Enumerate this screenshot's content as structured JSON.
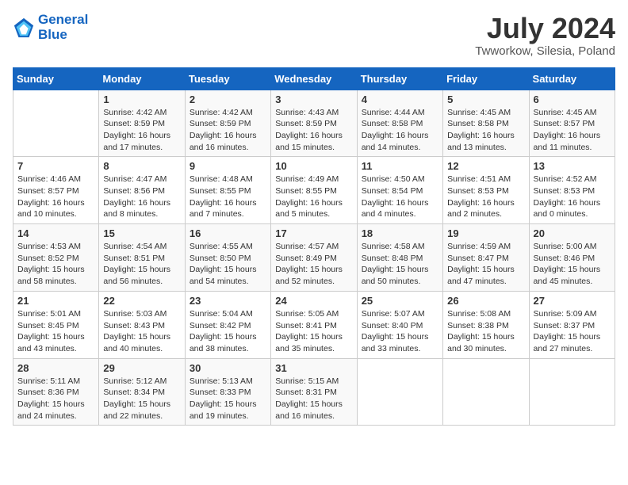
{
  "header": {
    "logo_line1": "General",
    "logo_line2": "Blue",
    "month_year": "July 2024",
    "location": "Twworkow, Silesia, Poland"
  },
  "days_of_week": [
    "Sunday",
    "Monday",
    "Tuesday",
    "Wednesday",
    "Thursday",
    "Friday",
    "Saturday"
  ],
  "weeks": [
    [
      {
        "day": "",
        "info": ""
      },
      {
        "day": "1",
        "info": "Sunrise: 4:42 AM\nSunset: 8:59 PM\nDaylight: 16 hours\nand 17 minutes."
      },
      {
        "day": "2",
        "info": "Sunrise: 4:42 AM\nSunset: 8:59 PM\nDaylight: 16 hours\nand 16 minutes."
      },
      {
        "day": "3",
        "info": "Sunrise: 4:43 AM\nSunset: 8:59 PM\nDaylight: 16 hours\nand 15 minutes."
      },
      {
        "day": "4",
        "info": "Sunrise: 4:44 AM\nSunset: 8:58 PM\nDaylight: 16 hours\nand 14 minutes."
      },
      {
        "day": "5",
        "info": "Sunrise: 4:45 AM\nSunset: 8:58 PM\nDaylight: 16 hours\nand 13 minutes."
      },
      {
        "day": "6",
        "info": "Sunrise: 4:45 AM\nSunset: 8:57 PM\nDaylight: 16 hours\nand 11 minutes."
      }
    ],
    [
      {
        "day": "7",
        "info": "Sunrise: 4:46 AM\nSunset: 8:57 PM\nDaylight: 16 hours\nand 10 minutes."
      },
      {
        "day": "8",
        "info": "Sunrise: 4:47 AM\nSunset: 8:56 PM\nDaylight: 16 hours\nand 8 minutes."
      },
      {
        "day": "9",
        "info": "Sunrise: 4:48 AM\nSunset: 8:55 PM\nDaylight: 16 hours\nand 7 minutes."
      },
      {
        "day": "10",
        "info": "Sunrise: 4:49 AM\nSunset: 8:55 PM\nDaylight: 16 hours\nand 5 minutes."
      },
      {
        "day": "11",
        "info": "Sunrise: 4:50 AM\nSunset: 8:54 PM\nDaylight: 16 hours\nand 4 minutes."
      },
      {
        "day": "12",
        "info": "Sunrise: 4:51 AM\nSunset: 8:53 PM\nDaylight: 16 hours\nand 2 minutes."
      },
      {
        "day": "13",
        "info": "Sunrise: 4:52 AM\nSunset: 8:53 PM\nDaylight: 16 hours\nand 0 minutes."
      }
    ],
    [
      {
        "day": "14",
        "info": "Sunrise: 4:53 AM\nSunset: 8:52 PM\nDaylight: 15 hours\nand 58 minutes."
      },
      {
        "day": "15",
        "info": "Sunrise: 4:54 AM\nSunset: 8:51 PM\nDaylight: 15 hours\nand 56 minutes."
      },
      {
        "day": "16",
        "info": "Sunrise: 4:55 AM\nSunset: 8:50 PM\nDaylight: 15 hours\nand 54 minutes."
      },
      {
        "day": "17",
        "info": "Sunrise: 4:57 AM\nSunset: 8:49 PM\nDaylight: 15 hours\nand 52 minutes."
      },
      {
        "day": "18",
        "info": "Sunrise: 4:58 AM\nSunset: 8:48 PM\nDaylight: 15 hours\nand 50 minutes."
      },
      {
        "day": "19",
        "info": "Sunrise: 4:59 AM\nSunset: 8:47 PM\nDaylight: 15 hours\nand 47 minutes."
      },
      {
        "day": "20",
        "info": "Sunrise: 5:00 AM\nSunset: 8:46 PM\nDaylight: 15 hours\nand 45 minutes."
      }
    ],
    [
      {
        "day": "21",
        "info": "Sunrise: 5:01 AM\nSunset: 8:45 PM\nDaylight: 15 hours\nand 43 minutes."
      },
      {
        "day": "22",
        "info": "Sunrise: 5:03 AM\nSunset: 8:43 PM\nDaylight: 15 hours\nand 40 minutes."
      },
      {
        "day": "23",
        "info": "Sunrise: 5:04 AM\nSunset: 8:42 PM\nDaylight: 15 hours\nand 38 minutes."
      },
      {
        "day": "24",
        "info": "Sunrise: 5:05 AM\nSunset: 8:41 PM\nDaylight: 15 hours\nand 35 minutes."
      },
      {
        "day": "25",
        "info": "Sunrise: 5:07 AM\nSunset: 8:40 PM\nDaylight: 15 hours\nand 33 minutes."
      },
      {
        "day": "26",
        "info": "Sunrise: 5:08 AM\nSunset: 8:38 PM\nDaylight: 15 hours\nand 30 minutes."
      },
      {
        "day": "27",
        "info": "Sunrise: 5:09 AM\nSunset: 8:37 PM\nDaylight: 15 hours\nand 27 minutes."
      }
    ],
    [
      {
        "day": "28",
        "info": "Sunrise: 5:11 AM\nSunset: 8:36 PM\nDaylight: 15 hours\nand 24 minutes."
      },
      {
        "day": "29",
        "info": "Sunrise: 5:12 AM\nSunset: 8:34 PM\nDaylight: 15 hours\nand 22 minutes."
      },
      {
        "day": "30",
        "info": "Sunrise: 5:13 AM\nSunset: 8:33 PM\nDaylight: 15 hours\nand 19 minutes."
      },
      {
        "day": "31",
        "info": "Sunrise: 5:15 AM\nSunset: 8:31 PM\nDaylight: 15 hours\nand 16 minutes."
      },
      {
        "day": "",
        "info": ""
      },
      {
        "day": "",
        "info": ""
      },
      {
        "day": "",
        "info": ""
      }
    ]
  ]
}
